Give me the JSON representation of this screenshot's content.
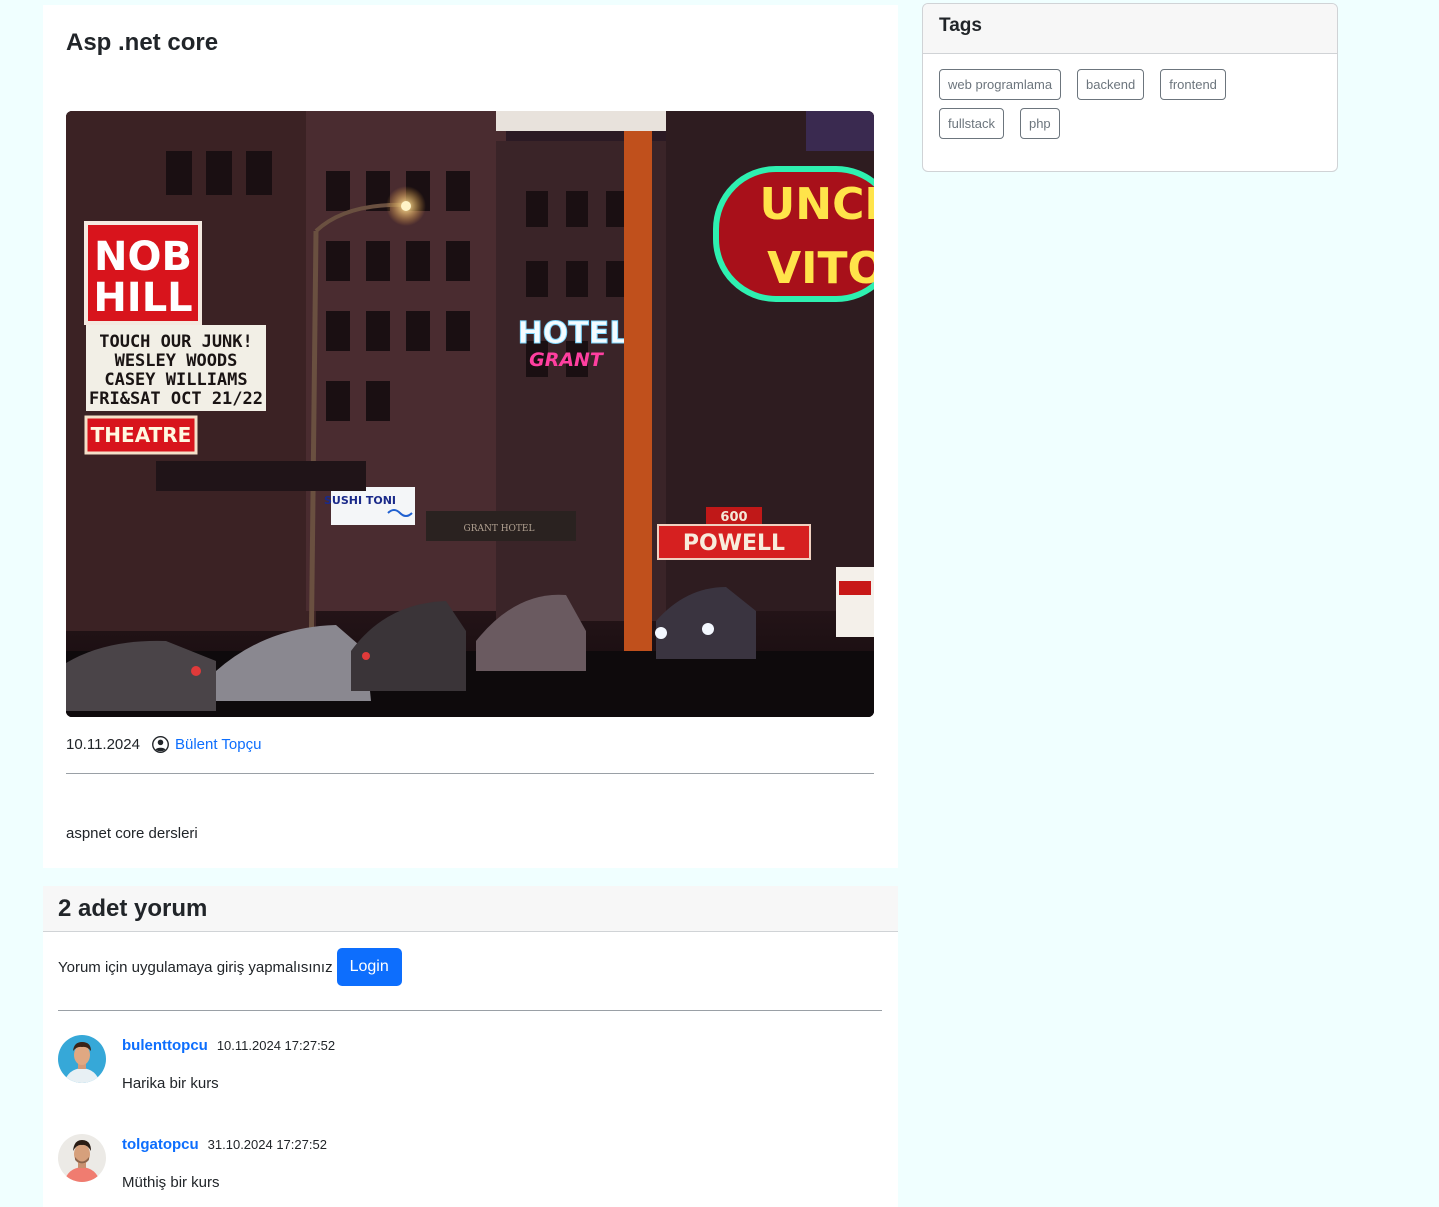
{
  "post": {
    "title": "Asp .net core",
    "date": "10.11.2024",
    "author": "Bülent Topçu",
    "content": "aspnet core dersleri",
    "image_signs": {
      "nob_hill_1": "NOB",
      "nob_hill_2": "HILL",
      "marquee_1": "TOUCH OUR JUNK!",
      "marquee_2": "WESLEY WOODS",
      "marquee_3": "CASEY WILLIAMS",
      "marquee_4": "FRI&SAT OCT 21/22",
      "theatre": "THEATRE",
      "hotel_1": "HOTEL",
      "hotel_2": "GRANT",
      "uncle_1": "UNCL",
      "uncle_2": "VITO",
      "sushi": "SUSHI TONI",
      "powell_num": "600",
      "powell": "POWELL",
      "grant_hotel": "GRANT HOTEL"
    }
  },
  "comments": {
    "header": "2 adet yorum",
    "login_prompt": "Yorum için uygulamaya giriş yapmalısınız",
    "login_label": "Login",
    "items": [
      {
        "user": "bulenttopcu",
        "date": "10.11.2024 17:27:52",
        "text": "Harika bir kurs"
      },
      {
        "user": "tolgatopcu",
        "date": "31.10.2024 17:27:52",
        "text": "Müthiş bir kurs"
      }
    ]
  },
  "tags": {
    "title": "Tags",
    "items": [
      "web programlama",
      "backend",
      "frontend",
      "fullstack",
      "php"
    ]
  },
  "colors": {
    "page_bg": "#f0ffff",
    "accent": "#0d6efd",
    "tag_border": "#6c757d"
  }
}
